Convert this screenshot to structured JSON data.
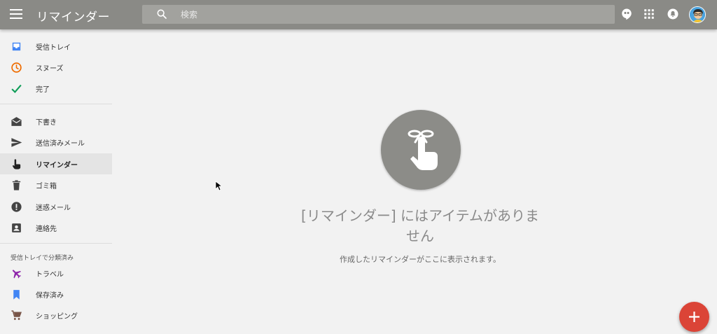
{
  "header": {
    "app_title": "リマインダー",
    "search_placeholder": "検索",
    "icons": [
      "menu-icon",
      "search-icon",
      "hangouts-icon",
      "apps-grid-icon",
      "notifications-icon",
      "avatar"
    ]
  },
  "sidebar": {
    "group1": [
      {
        "label": "受信トレイ",
        "icon": "inbox-icon",
        "color": "#4285f4"
      },
      {
        "label": "スヌーズ",
        "icon": "clock-icon",
        "color": "#ef6c00"
      },
      {
        "label": "完了",
        "icon": "check-icon",
        "color": "#0f9d58"
      }
    ],
    "group2": [
      {
        "label": "下書き",
        "icon": "drafts-icon"
      },
      {
        "label": "送信済みメール",
        "icon": "send-icon"
      },
      {
        "label": "リマインダー",
        "icon": "reminder-hand-icon",
        "active": true
      },
      {
        "label": "ゴミ箱",
        "icon": "trash-icon"
      },
      {
        "label": "迷惑メール",
        "icon": "spam-icon"
      },
      {
        "label": "連絡先",
        "icon": "contacts-icon"
      }
    ],
    "bundled_section_label": "受信トレイで分類済み",
    "group3": [
      {
        "label": "トラベル",
        "icon": "airplane-icon",
        "color": "#8e24aa"
      },
      {
        "label": "保存済み",
        "icon": "bookmark-icon",
        "color": "#4285f4"
      },
      {
        "label": "ショッピング",
        "icon": "cart-icon",
        "color": "#795548"
      }
    ]
  },
  "empty_state": {
    "title": "[リマインダー] にはアイテムがありません",
    "subtitle": "作成したリマインダーがここに表示されます。",
    "icon": "reminder-hand-icon"
  },
  "fab": {
    "icon": "plus-icon",
    "color": "#db4437"
  },
  "colors": {
    "header": "#8a8a86",
    "search": "#a2a29e",
    "background": "#f2f2f2",
    "active_item": "#e4e4e4"
  }
}
